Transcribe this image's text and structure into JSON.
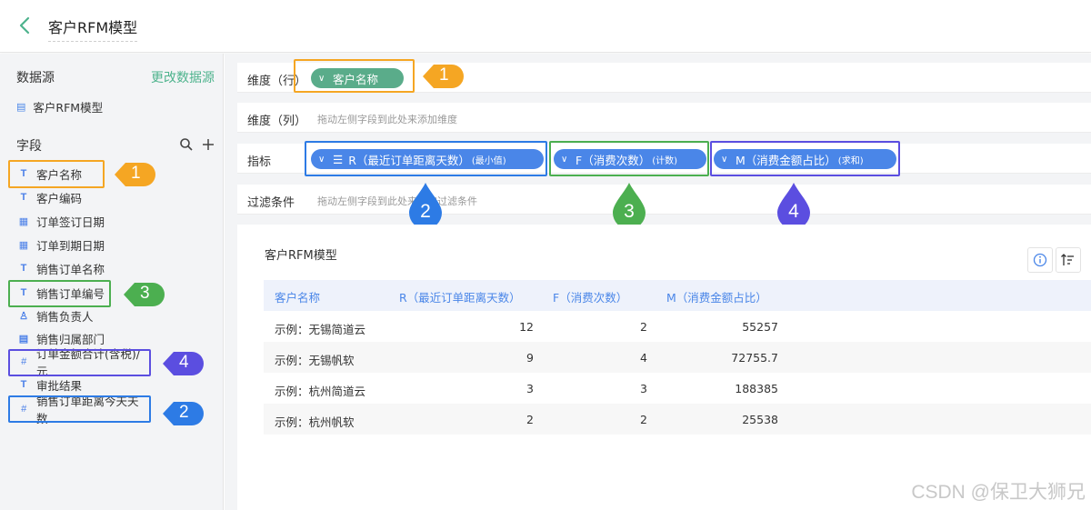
{
  "header": {
    "title": "客户RFM模型"
  },
  "sidebar": {
    "datasource_label": "数据源",
    "change_datasource": "更改数据源",
    "datasource_name": "客户RFM模型",
    "fields_label": "字段",
    "fields": [
      {
        "type": "text",
        "icon": "T",
        "label": "客户名称"
      },
      {
        "type": "text",
        "icon": "T",
        "label": "客户编码"
      },
      {
        "type": "date",
        "icon": "▦",
        "label": "订单签订日期"
      },
      {
        "type": "date",
        "icon": "▦",
        "label": "订单到期日期"
      },
      {
        "type": "text",
        "icon": "T",
        "label": "销售订单名称"
      },
      {
        "type": "text",
        "icon": "T",
        "label": "销售订单编号"
      },
      {
        "type": "user",
        "icon": "♙",
        "label": "销售负责人"
      },
      {
        "type": "dept",
        "icon": "▤",
        "label": "销售归属部门"
      },
      {
        "type": "number",
        "icon": "#",
        "label": "订单金额合计(含税)/元"
      },
      {
        "type": "text",
        "icon": "T",
        "label": "审批结果"
      },
      {
        "type": "number",
        "icon": "#",
        "label": "销售订单距离今天天数"
      }
    ]
  },
  "shelves": {
    "rows_dim": {
      "label": "维度（行）",
      "pill": "客户名称"
    },
    "cols_dim": {
      "label": "维度（列）",
      "hint": "拖动左侧字段到此处来添加维度"
    },
    "measures": {
      "label": "指标",
      "pills": [
        {
          "main": "R（最近订单距离天数）",
          "agg": "(最小值)"
        },
        {
          "main": "F（消费次数）",
          "agg": "(计数)"
        },
        {
          "main": "M（消费金额占比）",
          "agg": "(求和)"
        }
      ]
    },
    "filter": {
      "label": "过滤条件",
      "hint": "拖动左侧字段到此处来添加过滤条件"
    }
  },
  "badges": {
    "field_badges": [
      "1",
      "3",
      "4",
      "2"
    ],
    "shelf_badges": [
      "1",
      "2",
      "3",
      "4"
    ]
  },
  "table": {
    "title": "客户RFM模型",
    "columns": [
      "客户名称",
      "R（最近订单距离天数）",
      "F（消费次数）",
      "M（消费金额占比）"
    ],
    "rows": [
      [
        "示例：无锡简道云",
        "12",
        "2",
        "55257"
      ],
      [
        "示例：无锡帆软",
        "9",
        "4",
        "72755.7"
      ],
      [
        "示例：杭州简道云",
        "3",
        "3",
        "188385"
      ],
      [
        "示例：杭州帆软",
        "2",
        "2",
        "25538"
      ]
    ]
  },
  "colors": {
    "orange": "#f5a623",
    "green": "#4caf50",
    "blue": "#2d7be5",
    "purple": "#5b4ee0",
    "accent": "#4eb38d"
  },
  "watermark": "CSDN @保卫大狮兄"
}
